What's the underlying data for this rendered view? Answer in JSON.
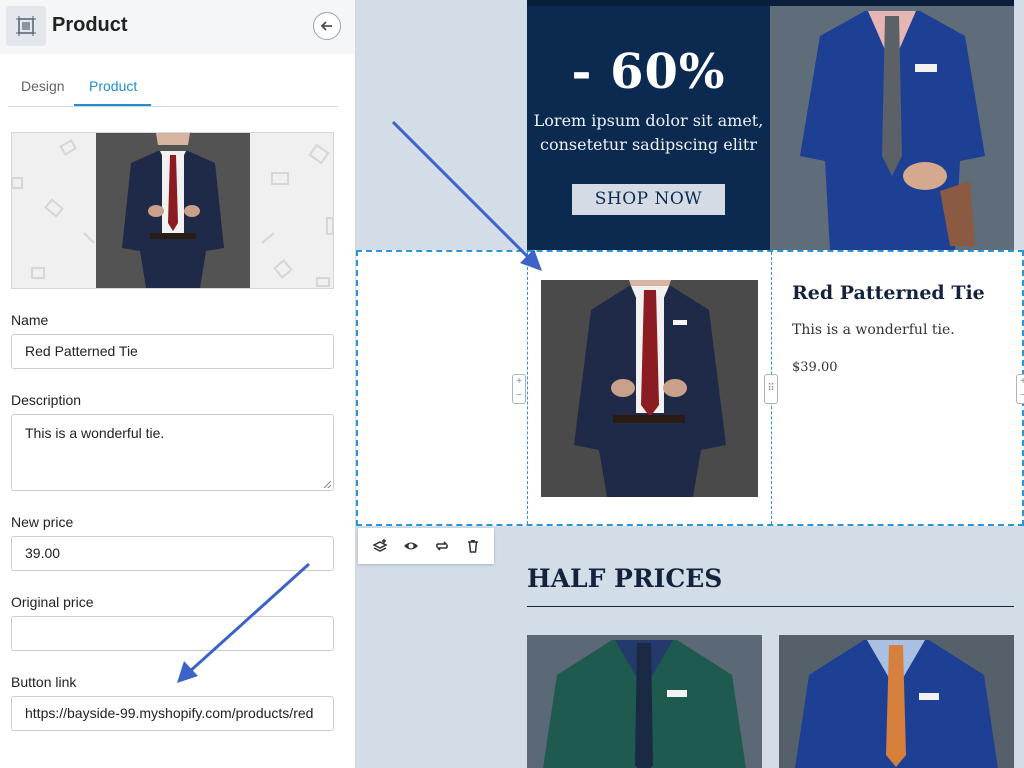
{
  "panel": {
    "title": "Product",
    "product_icon": "product-block-icon",
    "back_icon": "arrow-left-icon"
  },
  "tabs": [
    {
      "label": "Design",
      "active": false
    },
    {
      "label": "Product",
      "active": true
    }
  ],
  "fields": {
    "name_label": "Name",
    "name_value": "Red Patterned Tie",
    "description_label": "Description",
    "description_value": "This is a wonderful tie.",
    "new_price_label": "New price",
    "new_price_value": "39.00",
    "original_price_label": "Original price",
    "original_price_value": "",
    "button_link_label": "Button link",
    "button_link_value": "https://bayside-99.myshopify.com/products/red"
  },
  "promo": {
    "headline": "- 60%",
    "text": "Lorem ipsum dolor sit amet, consetetur sadipscing elitr",
    "button_label": "SHOP NOW"
  },
  "product_card": {
    "title": "Red Patterned Tie",
    "description": "This is a wonderful tie.",
    "price": "$39.00"
  },
  "toolbar": {
    "icons": [
      "layers-icon",
      "eye-icon",
      "swap-icon",
      "trash-icon"
    ]
  },
  "section": {
    "heading": "HALF PRICES"
  },
  "colors": {
    "accent": "#1f8fcf",
    "navy": "#0c2a50",
    "canvas_bg": "#d3dde8",
    "arrow": "#3d63c9"
  }
}
